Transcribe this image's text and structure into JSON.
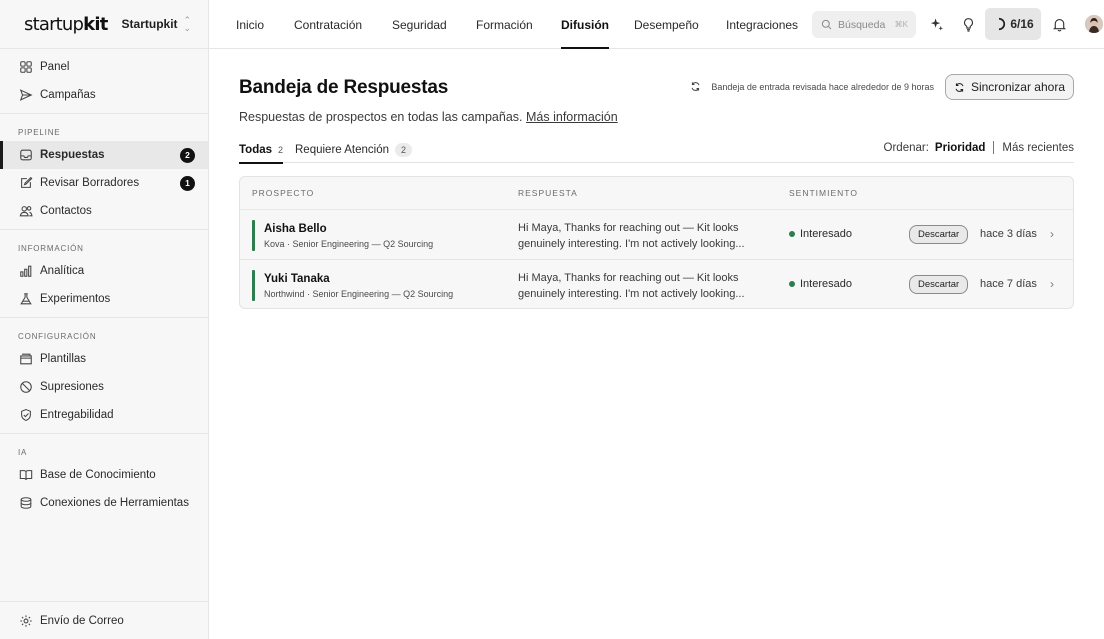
{
  "brand": {
    "logo_light": "startup",
    "logo_bold": "kit",
    "workspace": "Startupkit"
  },
  "sidebar": {
    "top": [
      {
        "label": "Panel",
        "icon": "grid-icon"
      },
      {
        "label": "Campañas",
        "icon": "send-icon"
      }
    ],
    "groups": [
      {
        "title": "PIPELINE",
        "items": [
          {
            "label": "Respuestas",
            "icon": "inbox-icon",
            "badge": "2",
            "active": true
          },
          {
            "label": "Revisar Borradores",
            "icon": "edit-icon",
            "badge": "1"
          },
          {
            "label": "Contactos",
            "icon": "users-icon"
          }
        ]
      },
      {
        "title": "INFORMACIÓN",
        "items": [
          {
            "label": "Analítica",
            "icon": "bar-chart-icon"
          },
          {
            "label": "Experimentos",
            "icon": "flask-icon"
          }
        ]
      },
      {
        "title": "CONFIGURACIÓN",
        "items": [
          {
            "label": "Plantillas",
            "icon": "folder-icon"
          },
          {
            "label": "Supresiones",
            "icon": "ban-icon"
          },
          {
            "label": "Entregabilidad",
            "icon": "shield-check-icon"
          }
        ]
      },
      {
        "title": "IA",
        "items": [
          {
            "label": "Base de Conocimiento",
            "icon": "book-icon"
          },
          {
            "label": "Conexiones de Herramientas",
            "icon": "database-icon"
          }
        ]
      }
    ],
    "footer": {
      "label": "Envío de Correo",
      "icon": "gear-icon"
    }
  },
  "topbar": {
    "tabs": [
      "Inicio",
      "Contratación",
      "Seguridad",
      "Formación",
      "Difusión",
      "Desempeño",
      "Integraciones"
    ],
    "active_tab": "Difusión",
    "search_placeholder": "Búsqueda",
    "search_shortcut": "⌘K",
    "progress": "6/16"
  },
  "main": {
    "title": "Bandeja de Respuestas",
    "subtitle": "Respuestas de prospectos en todas las campañas.",
    "more_link": "Más información",
    "sync_status": "Bandeja de entrada revisada hace alrededor de 9 horas",
    "sync_button": "Sincronizar ahora",
    "filters": [
      {
        "label": "Todas",
        "count": "2"
      },
      {
        "label": "Requiere Atención",
        "count": "2"
      }
    ],
    "sort_label": "Ordenar:",
    "sort_options": [
      "Prioridad",
      "Más recientes"
    ],
    "columns": [
      "PROSPECTO",
      "RESPUESTA",
      "SENTIMIENTO"
    ],
    "status_color": "#2f7d4f",
    "rows": [
      {
        "name": "Aisha Bello",
        "meta": "Kova · Senior Engineering — Q2 Sourcing",
        "reply_line1": "Hi Maya, Thanks for reaching out — Kit looks",
        "reply_line2": "genuinely interesting. I'm not actively looking...",
        "sentiment": "Interesado",
        "action": "Descartar",
        "time": "hace 3 días"
      },
      {
        "name": "Yuki Tanaka",
        "meta": "Northwind · Senior Engineering — Q2 Sourcing",
        "reply_line1": "Hi Maya, Thanks for reaching out — Kit looks",
        "reply_line2": "genuinely interesting. I'm not actively looking...",
        "sentiment": "Interesado",
        "action": "Descartar",
        "time": "hace 7 días"
      }
    ]
  }
}
